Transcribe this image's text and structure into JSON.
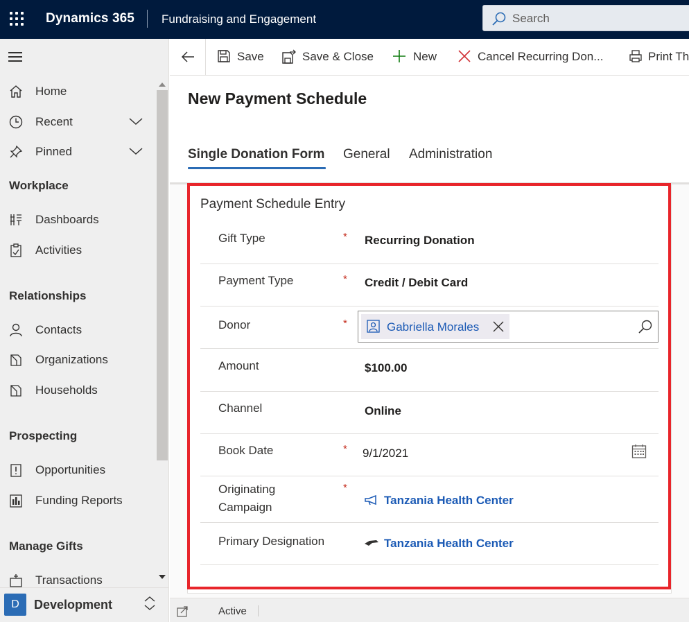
{
  "topbar": {
    "brand": "Dynamics 365",
    "app_name": "Fundraising and Engagement",
    "search_placeholder": "Search"
  },
  "nav": {
    "items_top": [
      {
        "label": "Home",
        "icon": "home-icon"
      },
      {
        "label": "Recent",
        "icon": "clock-icon",
        "expandable": true
      },
      {
        "label": "Pinned",
        "icon": "pin-icon",
        "expandable": true
      }
    ],
    "groups": [
      {
        "title": "Workplace",
        "items": [
          {
            "label": "Dashboards",
            "icon": "dashboard-icon"
          },
          {
            "label": "Activities",
            "icon": "clipboard-icon"
          }
        ]
      },
      {
        "title": "Relationships",
        "items": [
          {
            "label": "Contacts",
            "icon": "person-icon"
          },
          {
            "label": "Organizations",
            "icon": "organization-icon"
          },
          {
            "label": "Households",
            "icon": "household-icon"
          }
        ]
      },
      {
        "title": "Prospecting",
        "items": [
          {
            "label": "Opportunities",
            "icon": "opportunity-icon"
          },
          {
            "label": "Funding Reports",
            "icon": "report-icon"
          }
        ]
      },
      {
        "title": "Manage Gifts",
        "items": [
          {
            "label": "Transactions",
            "icon": "transaction-icon"
          }
        ]
      }
    ],
    "area": {
      "badge": "D",
      "name": "Development"
    }
  },
  "commands": {
    "save": "Save",
    "save_close": "Save & Close",
    "new": "New",
    "cancel_recurring": "Cancel Recurring Don...",
    "print": "Print Th"
  },
  "form": {
    "title": "New Payment Schedule",
    "tabs": [
      "Single Donation Form",
      "General",
      "Administration"
    ],
    "active_tab": "Single Donation Form",
    "section_title": "Payment Schedule Entry",
    "fields": {
      "gift_type": {
        "label": "Gift Type",
        "required": "*",
        "value": "Recurring Donation"
      },
      "payment_type": {
        "label": "Payment Type",
        "required": "*",
        "value": "Credit / Debit Card"
      },
      "donor": {
        "label": "Donor",
        "required": "*",
        "value": "Gabriella Morales"
      },
      "amount": {
        "label": "Amount",
        "value": "$100.00"
      },
      "channel": {
        "label": "Channel",
        "value": "Online"
      },
      "book_date": {
        "label": "Book Date",
        "required": "*",
        "value": "9/1/2021"
      },
      "originating_campaign": {
        "label_line1": "Originating",
        "label_line2": "Campaign",
        "required": "*",
        "value": "Tanzania Health Center"
      },
      "primary_designation": {
        "label": "Primary Designation",
        "value": "Tanzania Health Center"
      }
    }
  },
  "status": {
    "text": "Active"
  },
  "colors": {
    "topbar": "#001a3d",
    "accent": "#2b6cb5",
    "link": "#1b5ab5",
    "highlight_border": "#e8252b",
    "required": "#c42b1c",
    "new_icon": "#107c10",
    "cancel_icon": "#d13438"
  }
}
